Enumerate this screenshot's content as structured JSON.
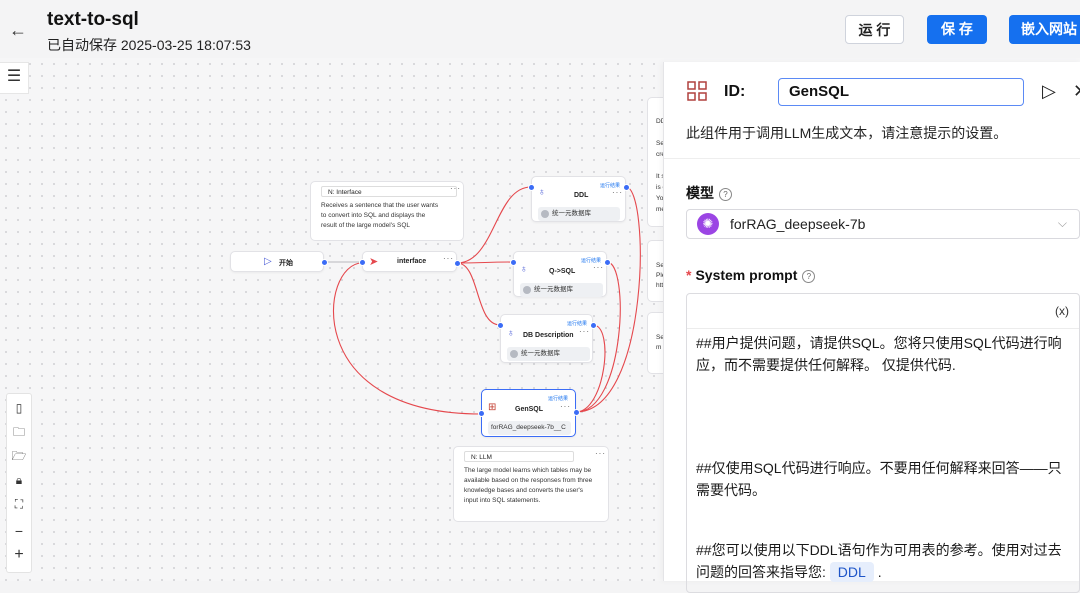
{
  "header": {
    "back_icon": "arrow-left-icon",
    "title": "text-to-sql",
    "autosave": "已自动保存 2025-03-25 18:07:53",
    "run_label": "运 行",
    "save_label": "保 存",
    "embed_label": "嵌入网站"
  },
  "canvas": {
    "nodes": {
      "start": {
        "label": "开始"
      },
      "interface": {
        "label": "interface"
      },
      "ddl": {
        "label": "DDL",
        "run": "运行结果",
        "kb": "统一元数据库"
      },
      "qsql": {
        "label": "Q->SQL",
        "run": "运行结果",
        "kb": "统一元数据库"
      },
      "dbdesc": {
        "label": "DB Description",
        "run": "运行结果",
        "kb": "统一元数据库"
      },
      "gensql": {
        "label": "GenSQL",
        "run": "运行结果",
        "model": "forRAG_deepseek-7b__C"
      }
    },
    "notes": {
      "interface_note": {
        "head": "N: Interface",
        "lines": [
          "Receives a sentence that the user wants",
          "to convert into SQL and displays the",
          "result of the large model's SQL"
        ]
      },
      "llm_note": {
        "head": "N: LLM",
        "lines": [
          "The large model learns which tables may be",
          "available based on the responses from three",
          "knowledge bases and converts the user's",
          "input into SQL statements."
        ]
      }
    },
    "partial_notes": {
      "note_top": [
        "DD",
        "Se",
        "cre",
        "It s",
        "is c",
        "Yo",
        "me"
      ],
      "note_mid": [
        "Se",
        "Ple",
        "htt"
      ],
      "note_bot": [
        "Se",
        "m"
      ]
    }
  },
  "panel": {
    "id_label": "ID:",
    "id_value": "GenSQL",
    "description": "此组件用于调用LLM生成文本，请注意提示的设置。",
    "model_label": "模型",
    "model_value": "forRAG_deepseek-7b",
    "system_prompt_label": "System prompt",
    "variable_icon": "(x)",
    "prompt_p1": "##用户提供问题，请提供SQL。您将只使用SQL代码进行响应，而不需要提供任何解释。 仅提供代码.",
    "prompt_p2": "##仅使用SQL代码进行响应。不要用任何解释来回答——只需要代码。",
    "prompt_p3": "##您可以使用以下DDL语句作为可用表的参考。使用对过去问题的回答来指导您:",
    "prompt_tag": "DDL",
    "prompt_p3_end": "."
  },
  "colors": {
    "accent": "#1570ef",
    "edge": "#e5484d",
    "port": "#3b6cf6"
  }
}
